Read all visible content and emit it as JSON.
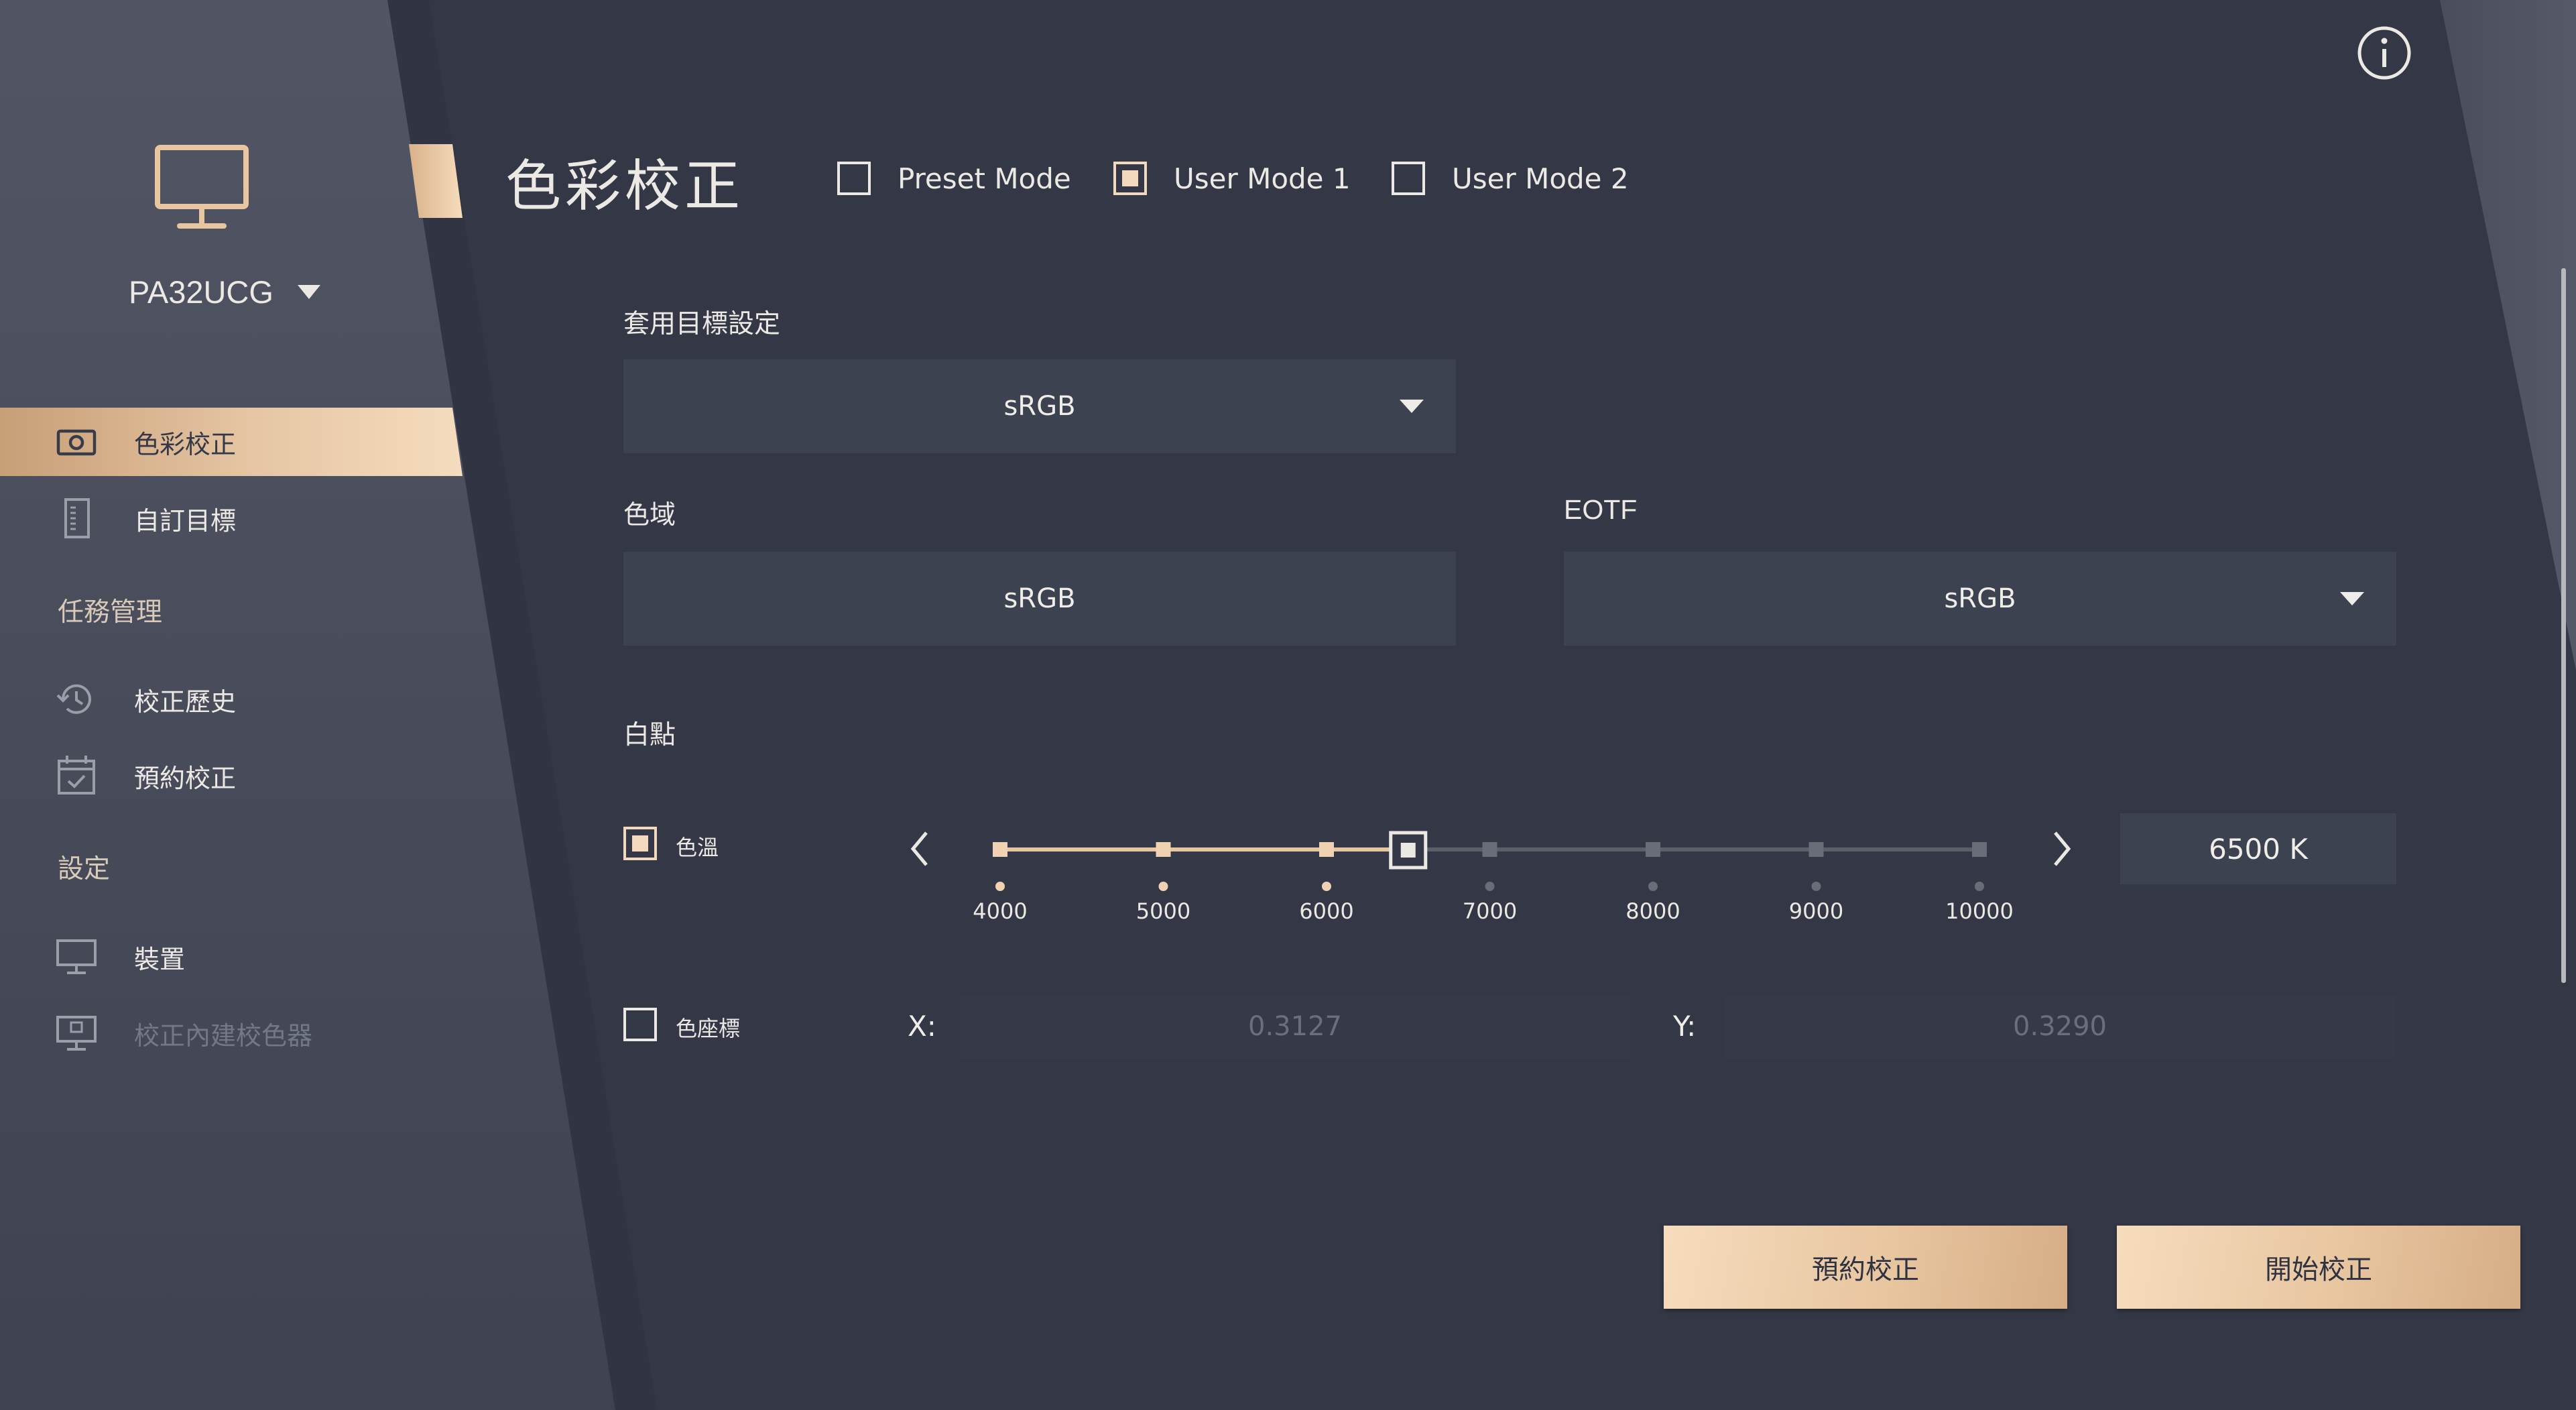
{
  "device": {
    "model": "PA32UCG"
  },
  "sidebar": {
    "items": [
      {
        "label": "色彩校正",
        "icon": "camera-icon",
        "active": true
      },
      {
        "label": "自訂目標",
        "icon": "document-icon"
      }
    ],
    "sections": [
      {
        "title": "任務管理",
        "items": [
          {
            "label": "校正歷史",
            "icon": "history-icon"
          },
          {
            "label": "預約校正",
            "icon": "calendar-check-icon"
          }
        ]
      },
      {
        "title": "設定",
        "items": [
          {
            "label": "裝置",
            "icon": "monitor-icon"
          },
          {
            "label": "校正內建校色器",
            "icon": "monitor-sensor-icon",
            "disabled": true
          }
        ]
      }
    ]
  },
  "header": {
    "title": "色彩校正",
    "modes": [
      {
        "label": "Preset Mode",
        "checked": false
      },
      {
        "label": "User Mode 1",
        "checked": true
      },
      {
        "label": "User Mode 2",
        "checked": false
      }
    ]
  },
  "form": {
    "target_label": "套用目標設定",
    "target_value": "sRGB",
    "gamut_label": "色域",
    "gamut_value": "sRGB",
    "eotf_label": "EOTF",
    "eotf_value": "sRGB",
    "whitepoint_label": "白點",
    "color_temp": {
      "label": "色溫",
      "checked": true,
      "ticks": [
        "4000",
        "5000",
        "6000",
        "7000",
        "8000",
        "9000",
        "10000"
      ],
      "value": 6500,
      "min": 4000,
      "max": 10000,
      "display": "6500 K"
    },
    "color_coord": {
      "label": "色座標",
      "checked": false,
      "x_label": "X:",
      "x_value": "0.3127",
      "y_label": "Y:",
      "y_value": "0.3290"
    }
  },
  "actions": {
    "schedule": "預約校正",
    "start": "開始校正"
  },
  "colors": {
    "background": "#343846",
    "accent": "#e8c6a0",
    "field": "#3d4251"
  }
}
